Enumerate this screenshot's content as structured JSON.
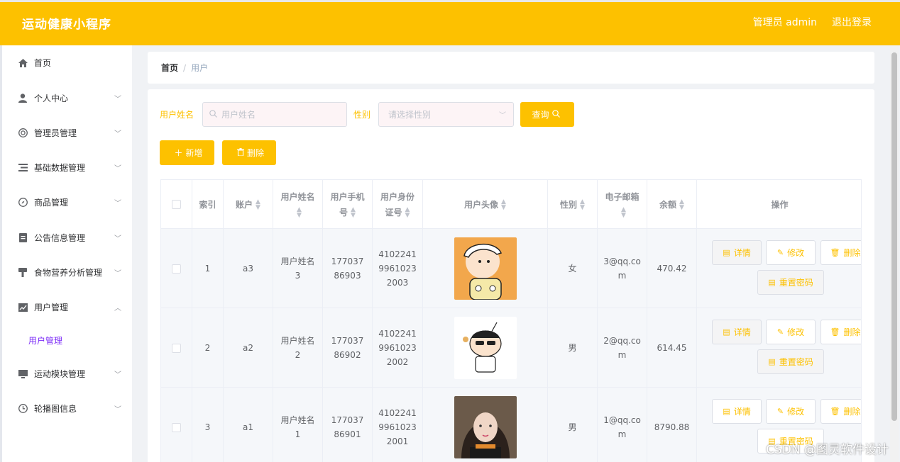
{
  "header": {
    "brand": "运动健康小程序",
    "admin_text": "管理员 admin",
    "logout": "退出登录"
  },
  "sidebar": {
    "items": [
      {
        "label": "首页",
        "icon": "home-icon",
        "arrow": ""
      },
      {
        "label": "个人中心",
        "icon": "user-icon",
        "arrow": "chevron-down-icon"
      },
      {
        "label": "管理员管理",
        "icon": "settings-circle-icon",
        "arrow": "chevron-down-icon"
      },
      {
        "label": "基础数据管理",
        "icon": "list-icon",
        "arrow": "chevron-down-icon"
      },
      {
        "label": "商品管理",
        "icon": "compass-icon",
        "arrow": "chevron-down-icon"
      },
      {
        "label": "公告信息管理",
        "icon": "document-icon",
        "arrow": "chevron-down-icon"
      },
      {
        "label": "食物营养分析管理",
        "icon": "stamp-icon",
        "arrow": "chevron-down-icon"
      },
      {
        "label": "用户管理",
        "icon": "chart-icon",
        "arrow": "chevron-up-icon"
      },
      {
        "label": "运动模块管理",
        "icon": "monitor-icon",
        "arrow": "chevron-down-icon"
      },
      {
        "label": "轮播图信息",
        "icon": "clock-icon",
        "arrow": "chevron-down-icon"
      }
    ],
    "submenu": {
      "label": "用户管理",
      "color": "#7d2ef7"
    }
  },
  "breadcrumb": {
    "home": "首页",
    "sep": "/",
    "current": "用户"
  },
  "search": {
    "name_label": "用户姓名",
    "name_placeholder": "用户姓名",
    "gender_label": "性别",
    "gender_placeholder": "请选择性别",
    "query_button": "查询"
  },
  "actions": {
    "add": "新增",
    "delete": "删除"
  },
  "table": {
    "headers": {
      "index": "索引",
      "account": "账户",
      "name": "用户姓名",
      "phone": "用户手机号",
      "idcard": "用户身份证号",
      "avatar": "用户头像",
      "gender": "性别",
      "email": "电子邮箱",
      "balance": "余额",
      "ops": "操作"
    },
    "rows": [
      {
        "index": "1",
        "account": "a3",
        "name": "用户姓名3",
        "phone": "17703786903",
        "idcard": "410224199610232003",
        "gender": "女",
        "email": "3@qq.com",
        "balance": "470.42"
      },
      {
        "index": "2",
        "account": "a2",
        "name": "用户姓名2",
        "phone": "17703786902",
        "idcard": "410224199610232002",
        "gender": "男",
        "email": "2@qq.com",
        "balance": "614.45"
      },
      {
        "index": "3",
        "account": "a1",
        "name": "用户姓名1",
        "phone": "17703786901",
        "idcard": "410224199610232001",
        "gender": "男",
        "email": "1@qq.com",
        "balance": "8790.88"
      }
    ],
    "op_labels": {
      "detail": "详情",
      "edit": "修改",
      "delete": "删除",
      "reset": "重置密码"
    }
  },
  "watermark": "CSDN @图灵软件设计",
  "colors": {
    "accent": "#fdc100",
    "submenu_active": "#7d2ef7"
  }
}
